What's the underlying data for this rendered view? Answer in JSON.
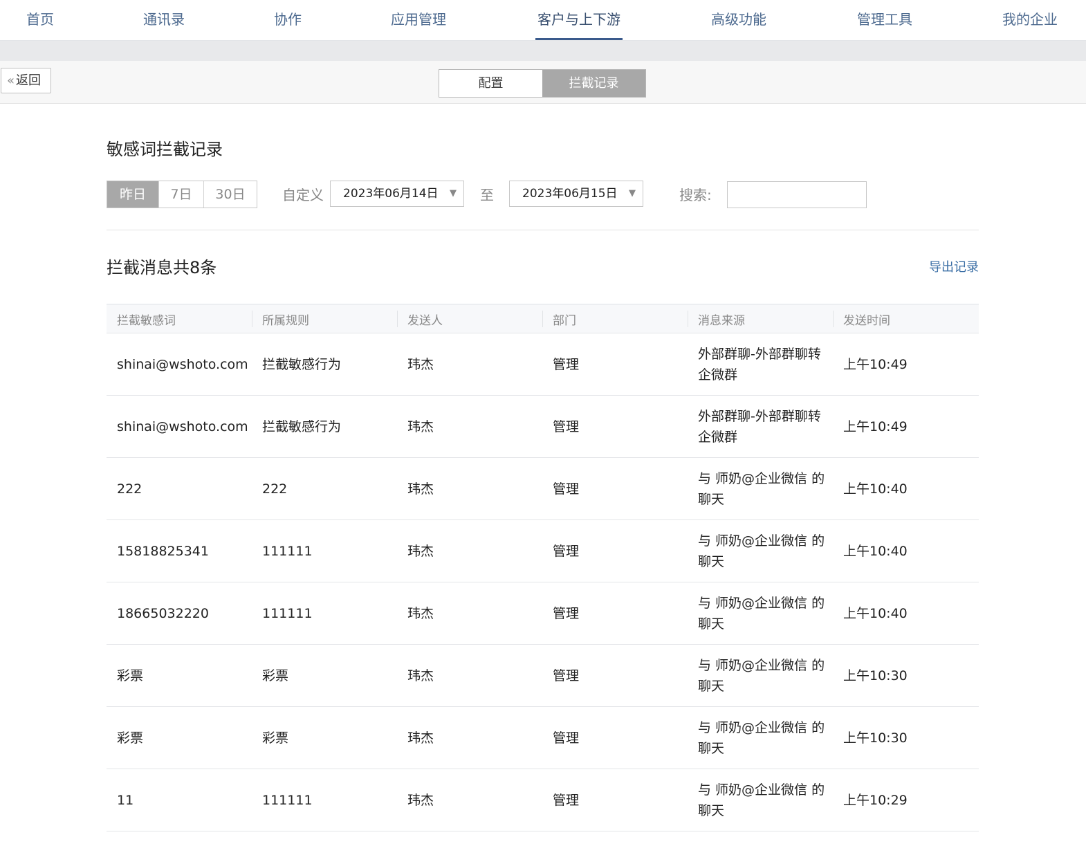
{
  "nav": {
    "items": [
      {
        "label": "首页"
      },
      {
        "label": "通讯录"
      },
      {
        "label": "协作"
      },
      {
        "label": "应用管理"
      },
      {
        "label": "客户与上下游",
        "active": true
      },
      {
        "label": "高级功能"
      },
      {
        "label": "管理工具"
      },
      {
        "label": "我的企业"
      }
    ]
  },
  "subbar": {
    "back_label": "返回",
    "tabs": [
      {
        "label": "配置"
      },
      {
        "label": "拦截记录",
        "active": true
      }
    ]
  },
  "page": {
    "title": "敏感词拦截记录"
  },
  "filters": {
    "quick": [
      {
        "label": "昨日",
        "active": true
      },
      {
        "label": "7日"
      },
      {
        "label": "30日"
      }
    ],
    "custom_label": "自定义",
    "start_date": "2023年06月14日",
    "to_label": "至",
    "end_date": "2023年06月15日",
    "search_label": "搜索:",
    "search_value": ""
  },
  "summary": {
    "count_title": "拦截消息共8条",
    "export_label": "导出记录"
  },
  "table": {
    "columns": [
      "拦截敏感词",
      "所属规则",
      "发送人",
      "部门",
      "消息来源",
      "发送时间"
    ],
    "rows": [
      [
        "shinai@wshoto.com",
        "拦截敏感行为",
        "玮杰",
        "管理",
        "外部群聊-外部群聊转企微群",
        "上午10:49"
      ],
      [
        "shinai@wshoto.com",
        "拦截敏感行为",
        "玮杰",
        "管理",
        "外部群聊-外部群聊转企微群",
        "上午10:49"
      ],
      [
        "222",
        "222",
        "玮杰",
        "管理",
        "与 师奶@企业微信 的聊天",
        "上午10:40"
      ],
      [
        "15818825341",
        "111111",
        "玮杰",
        "管理",
        "与 师奶@企业微信 的聊天",
        "上午10:40"
      ],
      [
        "18665032220",
        "111111",
        "玮杰",
        "管理",
        "与 师奶@企业微信 的聊天",
        "上午10:40"
      ],
      [
        "彩票",
        "彩票",
        "玮杰",
        "管理",
        "与 师奶@企业微信 的聊天",
        "上午10:30"
      ],
      [
        "彩票",
        "彩票",
        "玮杰",
        "管理",
        "与 师奶@企业微信 的聊天",
        "上午10:30"
      ],
      [
        "11",
        "111111",
        "玮杰",
        "管理",
        "与 师奶@企业微信 的聊天",
        "上午10:29"
      ]
    ]
  },
  "colors": {
    "nav_text": "#4d6a8f",
    "nav_active_underline": "#3a5a8c",
    "segment_active_bg": "#a8a8a8",
    "link": "#3a6ea5"
  },
  "icons": {
    "back": "double-chevron-left-icon",
    "dropdown": "triangle-down-icon"
  }
}
